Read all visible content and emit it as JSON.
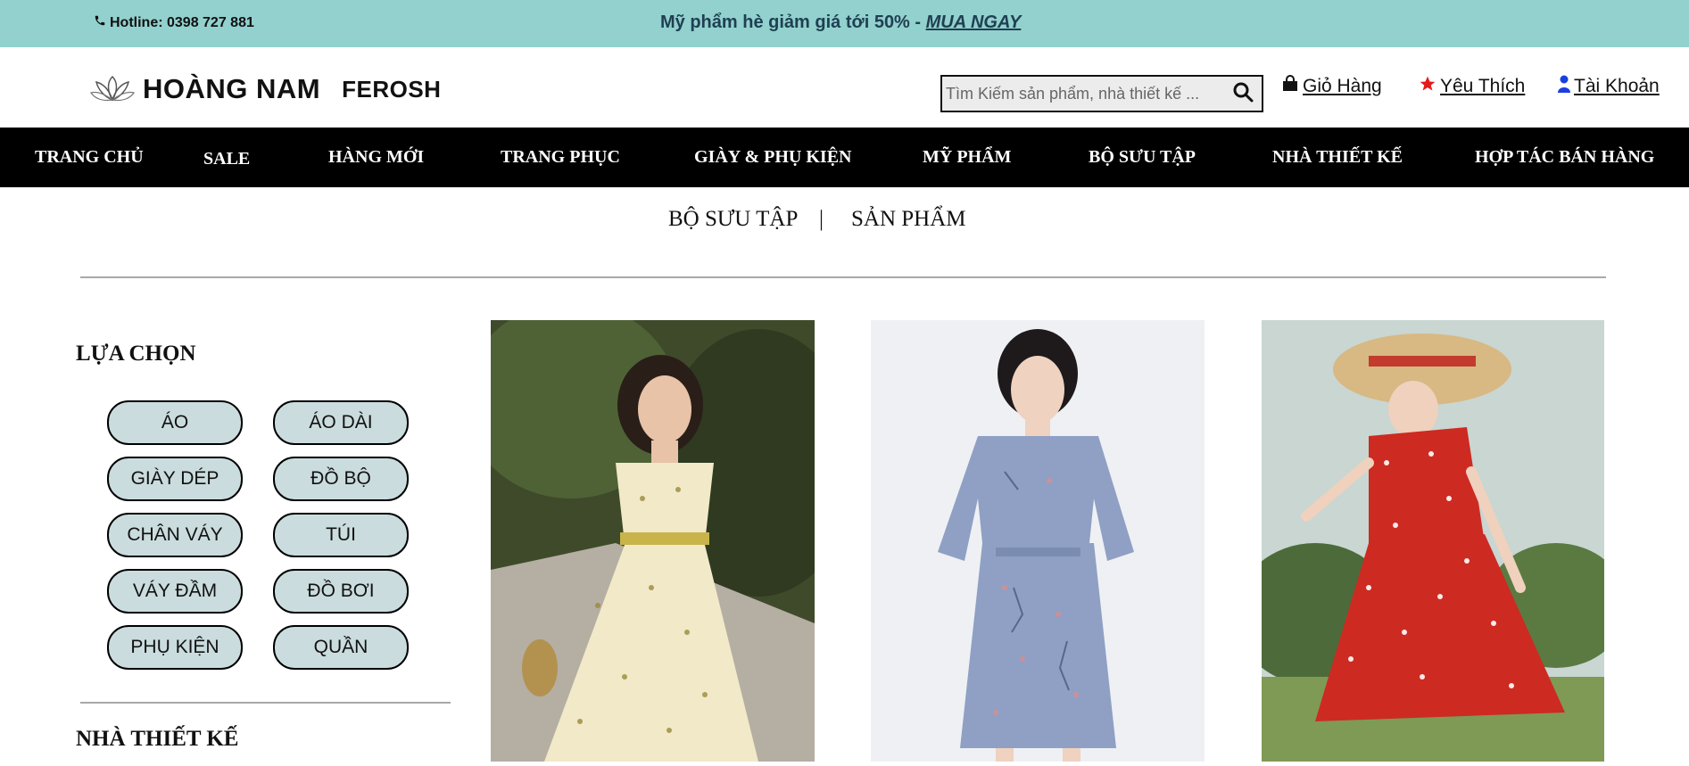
{
  "topbar": {
    "hotline": "Hotline: 0398 727 881",
    "promo_text": "Mỹ phẩm hè giảm giá tới 50% - ",
    "promo_link": "MUA NGAY",
    "bg_color": "#92d1ce"
  },
  "header": {
    "logo_name": "HOÀNG NAM",
    "logo_sub": "FEROSH",
    "search_placeholder": "Tìm Kiếm sản phẩm, nhà thiết kế ...",
    "cart_label": " Giỏ Hàng",
    "wishlist_label": " Yêu Thích",
    "account_label": " Tài Khoản",
    "icons": [
      "phone-icon",
      "search-icon",
      "bag-icon",
      "star-icon",
      "user-icon"
    ]
  },
  "nav": {
    "items": [
      "TRANG CHỦ",
      "SALE",
      "HÀNG MỚI",
      "TRANG PHỤC",
      "GIÀY & PHỤ KIỆN",
      "MỸ PHẨM",
      "BỘ SƯU TẬP",
      "NHÀ THIẾT KẾ",
      "HỢP TÁC BÁN HÀNG"
    ]
  },
  "subtabs": {
    "collection": "BỘ SƯU TẬP",
    "separator": "|",
    "products": "SẢN PHẨM"
  },
  "sidebar": {
    "choose_title": "LỰA CHỌN",
    "filters": [
      "ÁO",
      "ÁO DÀI",
      "GIÀY DÉP",
      "ĐỒ BỘ",
      "CHÂN VÁY",
      "TÚI",
      "VÁY ĐẦM",
      "ĐỒ BƠI",
      "PHỤ KIỆN",
      "QUẦN"
    ],
    "designer_title": "NHÀ THIẾT KẾ",
    "chip_color": "#cadcde"
  },
  "products": [
    {
      "image": "woman in floral yellow dress"
    },
    {
      "image": "woman in blue floral dress"
    },
    {
      "image": "woman in red polka dress with sun hat"
    }
  ]
}
